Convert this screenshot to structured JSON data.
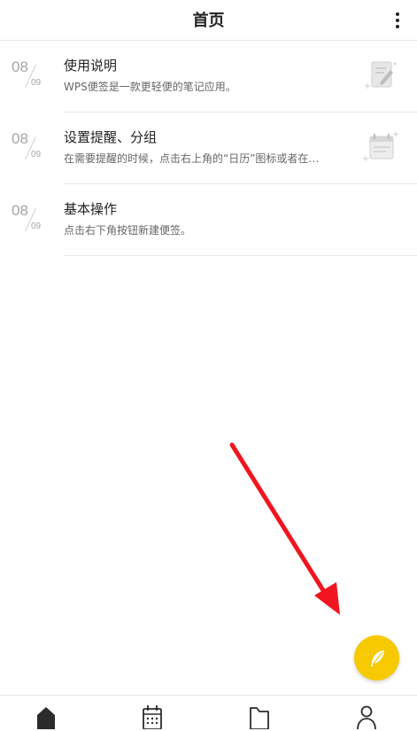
{
  "header": {
    "title": "首页",
    "more_icon": "more-vertical-icon"
  },
  "notes": [
    {
      "day": "08",
      "month": "09",
      "title": "使用说明",
      "summary": "WPS便签是一款更轻便的笔记应用。",
      "thumbnail": "note-pen-icon"
    },
    {
      "day": "08",
      "month": "09",
      "title": "设置提醒、分组",
      "summary": "在需要提醒的时候，点击右上角的“日历”图标或者在…",
      "thumbnail": "calendar-note-icon"
    },
    {
      "day": "08",
      "month": "09",
      "title": "基本操作",
      "summary": "点击右下角按钮新建便签。"
    }
  ],
  "fab": {
    "icon": "feather-icon",
    "color": "#f7c900"
  },
  "annotation": {
    "arrow_color": "#f0151e"
  },
  "bottom_nav": [
    {
      "icon": "home-icon"
    },
    {
      "icon": "calendar-icon"
    },
    {
      "icon": "folder-icon"
    },
    {
      "icon": "user-icon"
    }
  ]
}
